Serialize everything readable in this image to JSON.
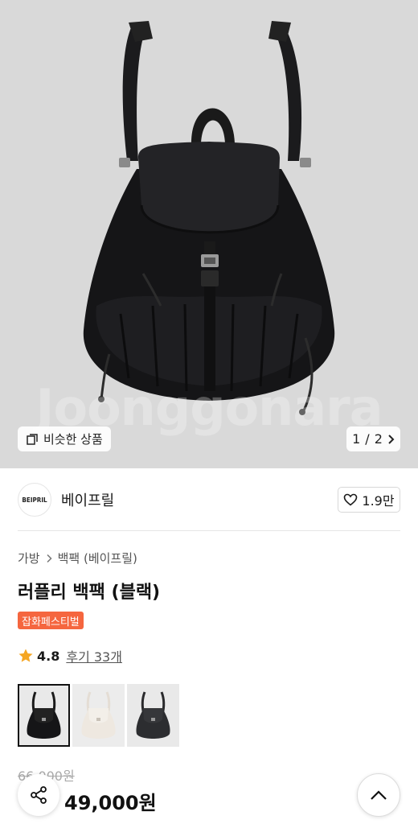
{
  "hero": {
    "watermark": "Joonggonara",
    "similar_label": "비슷한 상품",
    "pager_current": "1",
    "pager_sep": "/",
    "pager_total": "2"
  },
  "seller": {
    "logo_text": "BEIPRIL",
    "name": "베이프릴",
    "likes": "1.9만"
  },
  "product": {
    "breadcrumb": [
      "가방",
      "백팩 (베이프릴)"
    ],
    "title": "러플리 백팩 (블랙)",
    "badge": "잡화페스티벌",
    "rating": "4.8",
    "reviews_label": "후기 33개",
    "original_price": "66,000원",
    "discount": "",
    "price": "49,000원"
  },
  "thumbnails": [
    {
      "name": "black",
      "selected": true
    },
    {
      "name": "ivory",
      "selected": false
    },
    {
      "name": "charcoal",
      "selected": false
    }
  ],
  "colors": {
    "accent": "#f5663f",
    "star": "#f5a623",
    "hero_bg": "#d9d9d9"
  },
  "icons": {
    "similar": "copy-icon",
    "pager_next": "chevron-right-icon",
    "like": "heart-icon",
    "breadcrumb_sep": "chevron-right-icon",
    "rating": "star-icon",
    "share": "share-icon",
    "scroll_top": "chevron-up-icon"
  }
}
